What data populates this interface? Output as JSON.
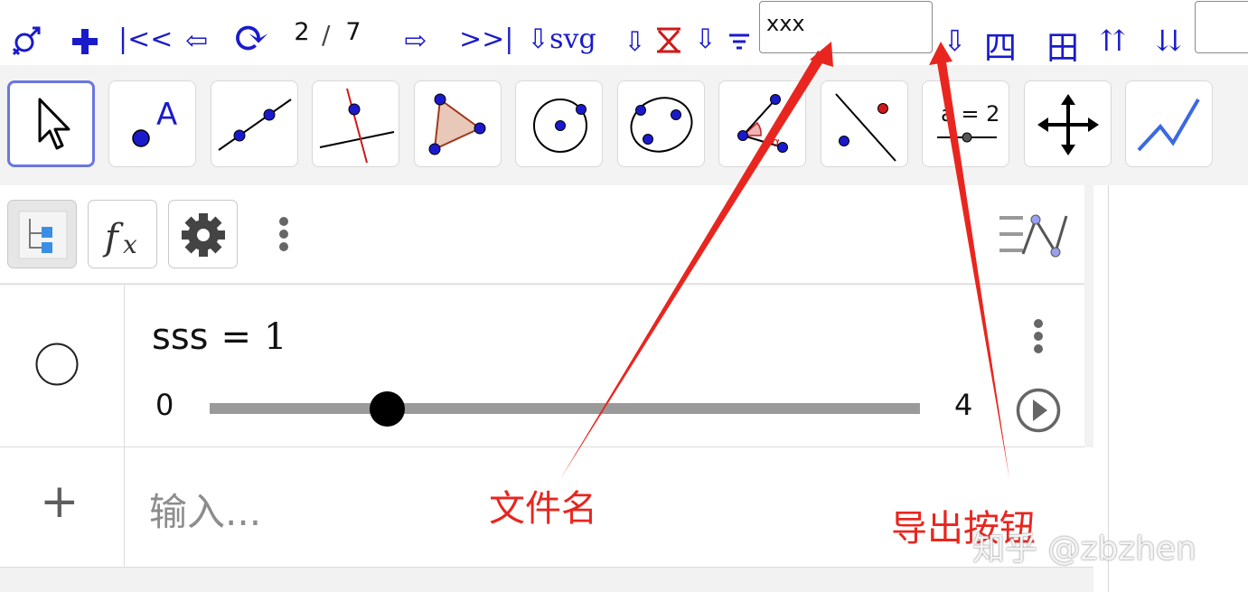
{
  "toolbar": {
    "first_label": "|<<",
    "prev_label": "⇦",
    "reload_icon": "⟳",
    "page_current": "2",
    "page_sep": "/",
    "page_total": "7",
    "next_label": "⇨",
    "last_label": ">>|",
    "export_svg_label": "⇩svg",
    "export_x_prefix": "⇩",
    "export_wifi_prefix": "⇩",
    "filename_value": "xxx",
    "export_button_label": "⇩",
    "btn_si_label": "四",
    "btn_tian_label": "田",
    "btn_up_label": "⇈",
    "btn_down_label": "⇊"
  },
  "tools": [
    {
      "name": "move-tool"
    },
    {
      "name": "point-tool"
    },
    {
      "name": "line-tool"
    },
    {
      "name": "perpendicular-line-tool"
    },
    {
      "name": "polygon-tool"
    },
    {
      "name": "circle-center-point-tool"
    },
    {
      "name": "conic-through-points-tool"
    },
    {
      "name": "angle-tool"
    },
    {
      "name": "reflect-tool"
    },
    {
      "name": "slider-tool",
      "label": "a = 2"
    },
    {
      "name": "move-graphics-view-tool"
    },
    {
      "name": "function-inspector-tool"
    }
  ],
  "algebra": {
    "item": {
      "name": "sss",
      "equals": "=",
      "value": "1",
      "slider_min": "0",
      "slider_max": "4",
      "slider_value": 1
    },
    "input_placeholder": "输入..."
  },
  "annotations": {
    "filename": "文件名",
    "export_button": "导出按钮",
    "watermark": "知乎 @zbzhen"
  },
  "colors": {
    "toolbar_blue": "#1a1acc",
    "annotation_red": "#e8261f",
    "active_tool_border": "#6b76e2"
  }
}
